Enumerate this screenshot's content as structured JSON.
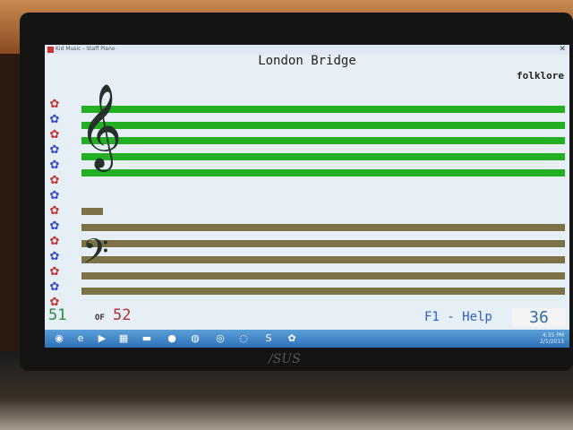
{
  "window": {
    "title": "Kid Music - Staff Piano"
  },
  "song": {
    "title": "London Bridge",
    "genre": "folklore"
  },
  "counter": {
    "current": "51",
    "of_label": "OF",
    "total": "52"
  },
  "help": {
    "label": "F1 - Help"
  },
  "score": {
    "value": "36"
  },
  "brand": {
    "text": "/SUS"
  },
  "colors": {
    "treble_staff": "#22b022",
    "bass_staff": "#7d7245",
    "flower_red": "#c83030",
    "flower_blue": "#3348c8"
  },
  "flowers": [
    "red",
    "blue",
    "red",
    "blue",
    "blue",
    "red",
    "blue",
    "red",
    "blue",
    "red",
    "blue",
    "red",
    "blue",
    "red"
  ],
  "taskbar": {
    "icons": [
      "start-orb-icon",
      "ie-icon",
      "media-player-icon",
      "explorer-icon",
      "folder-icon",
      "app-icon",
      "firefox-icon",
      "chrome-icon",
      "safari-icon",
      "skype-icon",
      "piano-app-icon"
    ],
    "clock_time": "4:35 PM",
    "clock_date": "2/1/2013"
  }
}
